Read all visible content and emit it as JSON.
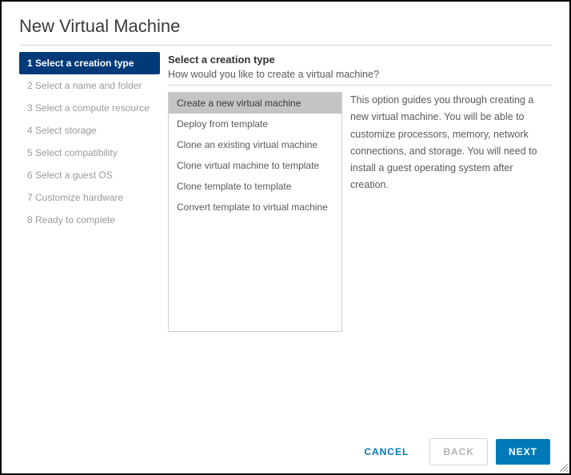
{
  "title": "New Virtual Machine",
  "sidebar": {
    "steps": [
      {
        "label": "1 Select a creation type",
        "active": true
      },
      {
        "label": "2 Select a name and folder",
        "active": false
      },
      {
        "label": "3 Select a compute resource",
        "active": false
      },
      {
        "label": "4 Select storage",
        "active": false
      },
      {
        "label": "5 Select compatibility",
        "active": false
      },
      {
        "label": "6 Select a guest OS",
        "active": false
      },
      {
        "label": "7 Customize hardware",
        "active": false
      },
      {
        "label": "8 Ready to complete",
        "active": false
      }
    ]
  },
  "main": {
    "heading": "Select a creation type",
    "subheading": "How would you like to create a virtual machine?",
    "options": [
      {
        "label": "Create a new virtual machine",
        "selected": true
      },
      {
        "label": "Deploy from template",
        "selected": false
      },
      {
        "label": "Clone an existing virtual machine",
        "selected": false
      },
      {
        "label": "Clone virtual machine to template",
        "selected": false
      },
      {
        "label": "Clone template to template",
        "selected": false
      },
      {
        "label": "Convert template to virtual machine",
        "selected": false
      }
    ],
    "description": "This option guides you through creating a new virtual machine. You will be able to customize processors, memory, network connections, and storage. You will need to install a guest operating system after creation."
  },
  "footer": {
    "cancel": "CANCEL",
    "back": "BACK",
    "next": "NEXT"
  }
}
